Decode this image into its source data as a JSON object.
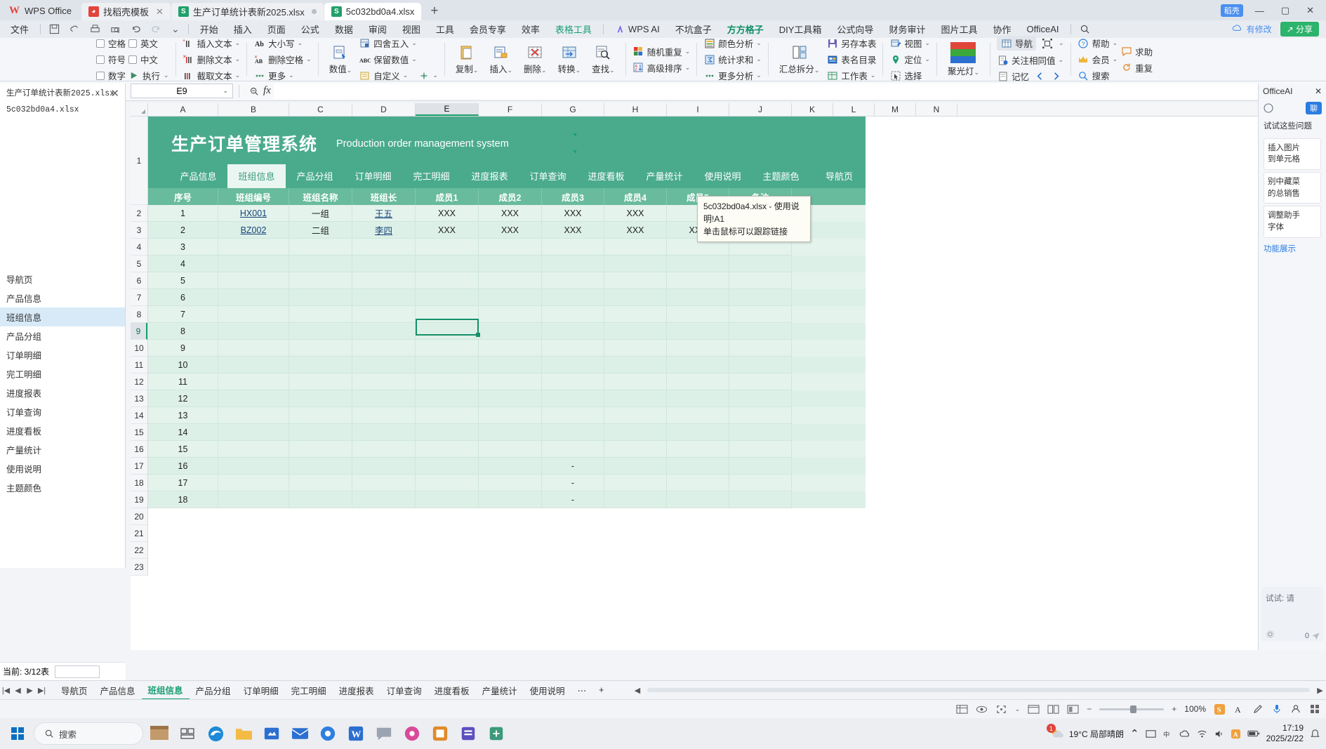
{
  "window": {
    "app_name": "WPS Office",
    "tabs": [
      {
        "label": "找稻壳模板",
        "icon": "wps-red-icon",
        "active": false,
        "closable": true
      },
      {
        "label": "生产订单统计表新2025.xlsx",
        "icon": "sheet-green-icon",
        "active": false,
        "dot": true
      },
      {
        "label": "5c032bd0a4.xlsx",
        "icon": "sheet-green-icon",
        "active": true
      }
    ],
    "new_tab": "+",
    "vip_badge": "稻壳",
    "minimize": "—",
    "maximize": "▢",
    "close": "✕"
  },
  "menu": {
    "file": "文件",
    "quick_access": [
      "save-icon",
      "cloud-icon",
      "print-icon",
      "print-preview-icon",
      "undo-icon",
      "redo-icon",
      "customize-chevron-icon"
    ],
    "items": [
      {
        "label": "开始"
      },
      {
        "label": "插入"
      },
      {
        "label": "页面"
      },
      {
        "label": "公式"
      },
      {
        "label": "数据"
      },
      {
        "label": "审阅"
      },
      {
        "label": "视图"
      },
      {
        "label": "工具"
      },
      {
        "label": "会员专享"
      },
      {
        "label": "效率"
      },
      {
        "label": "表格工具",
        "style": "teal"
      },
      {
        "label": "WPS AI",
        "style": "ai"
      },
      {
        "label": "不坑盒子"
      },
      {
        "label": "方方格子",
        "style": "active"
      },
      {
        "label": "DIY工具箱"
      },
      {
        "label": "公式向导"
      },
      {
        "label": "财务审计"
      },
      {
        "label": "图片工具"
      },
      {
        "label": "协作"
      },
      {
        "label": "OfficeAI"
      }
    ],
    "search_icon": "search-icon",
    "modified_label": "有修改",
    "share_label": "分享"
  },
  "ribbon": {
    "groups": [
      {
        "name": "checkboxes",
        "checkboxes": [
          {
            "label": "空格"
          },
          {
            "label": "英文"
          },
          {
            "label": "符号"
          },
          {
            "label": "中文"
          },
          {
            "label": "数字"
          },
          {
            "label": "执行"
          }
        ]
      },
      {
        "name": "text-tools",
        "items": [
          {
            "label": "插入文本",
            "icon": "insert-text-icon"
          },
          {
            "label": "删除文本",
            "icon": "delete-text-icon"
          },
          {
            "label": "截取文本",
            "icon": "extract-text-icon"
          }
        ]
      },
      {
        "name": "case-tools",
        "items": [
          {
            "label": "大小写",
            "icon": "case-icon"
          },
          {
            "label": "删除空格",
            "icon": "remove-space-icon"
          },
          {
            "label": "更多",
            "icon": "more-icon"
          }
        ]
      },
      {
        "name": "value-tools",
        "big": {
          "label": "数值",
          "icon": "numeric-icon"
        },
        "items": [
          {
            "label": "四舍五入",
            "icon": "round-icon"
          },
          {
            "label": "保留数值",
            "icon": "keep-value-icon"
          },
          {
            "label": "自定义",
            "icon": "custom-icon"
          },
          {
            "label": "",
            "icon": "plus-more-icon"
          }
        ]
      },
      {
        "name": "edit-tools",
        "buttons": [
          {
            "label": "复制",
            "icon": "copy-icon"
          },
          {
            "label": "插入",
            "icon": "insert-icon"
          },
          {
            "label": "删除",
            "icon": "delete-icon"
          },
          {
            "label": "转换",
            "icon": "convert-icon"
          },
          {
            "label": "查找",
            "icon": "find-icon"
          }
        ]
      },
      {
        "name": "random-sort",
        "items": [
          {
            "label": "随机重复",
            "icon": "random-repeat-icon"
          },
          {
            "label": "高级排序",
            "icon": "advanced-sort-icon"
          }
        ]
      },
      {
        "name": "analysis",
        "items": [
          {
            "label": "颜色分析",
            "icon": "color-analysis-icon"
          },
          {
            "label": "统计求和",
            "icon": "stat-sum-icon"
          },
          {
            "label": "更多分析",
            "icon": "more-analysis-icon"
          }
        ]
      },
      {
        "name": "workbook",
        "big": {
          "label": "汇总拆分",
          "icon": "merge-split-icon"
        },
        "items": [
          {
            "label": "另存本表",
            "icon": "save-sheet-icon"
          },
          {
            "label": "表名目录",
            "icon": "sheet-list-icon"
          },
          {
            "label": "工作表",
            "icon": "worksheet-icon"
          }
        ]
      },
      {
        "name": "view-tools",
        "items": [
          {
            "label": "视图",
            "icon": "view-icon"
          },
          {
            "label": "定位",
            "icon": "locate-icon"
          },
          {
            "label": "选择",
            "icon": "select-icon"
          }
        ]
      },
      {
        "name": "spotlight",
        "big": {
          "label": "聚光灯",
          "icon": "spotlight-icon"
        }
      },
      {
        "name": "navigation",
        "items": [
          {
            "label": "导航",
            "icon": "nav-icon",
            "selected": true
          },
          {
            "label": "关注相同值",
            "icon": "watch-same-icon"
          },
          {
            "label": "记忆",
            "icon": "memory-icon"
          }
        ],
        "extra": [
          {
            "label": "",
            "icon": "resize-icon"
          },
          {
            "label": "",
            "icon": "arrow-left-icon"
          },
          {
            "label": "",
            "icon": "arrow-right-icon"
          }
        ]
      },
      {
        "name": "help",
        "items": [
          {
            "label": "帮助",
            "icon": "help-icon"
          },
          {
            "label": "会员",
            "icon": "vip-icon"
          },
          {
            "label": "搜索",
            "icon": "search-small-icon"
          },
          {
            "label": "求助",
            "icon": "ask-icon"
          },
          {
            "label": "重复",
            "icon": "repeat-icon"
          }
        ]
      }
    ]
  },
  "formula_bar": {
    "name_box": "E9",
    "name_box_chevron": "chevron-down-icon",
    "zoom_icon": "search-minus-icon",
    "fx": "fx",
    "value": "",
    "expand_icon": "expand-formula-icon"
  },
  "left_panel": {
    "close": "✕",
    "files": [
      "生产订单统计表新2025.xlsx",
      "5c032bd0a4.xlsx"
    ],
    "nav_items": [
      {
        "label": "导航页"
      },
      {
        "label": "产品信息"
      },
      {
        "label": "班组信息",
        "selected": true
      },
      {
        "label": "产品分组"
      },
      {
        "label": "订单明细"
      },
      {
        "label": "完工明细"
      },
      {
        "label": "进度报表"
      },
      {
        "label": "订单查询"
      },
      {
        "label": "进度看板"
      },
      {
        "label": "产量统计"
      },
      {
        "label": "使用说明"
      },
      {
        "label": "主题颜色"
      }
    ],
    "count_label": "当前:  3/12表",
    "count_value": ""
  },
  "sheet": {
    "banner": {
      "title": "生产订单管理系统",
      "subtitle": "Production order management system"
    },
    "nav_tabs": [
      {
        "label": "产品信息",
        "active": false
      },
      {
        "label": "班组信息",
        "active": true
      },
      {
        "label": "产品分组",
        "active": false
      },
      {
        "label": "订单明细",
        "active": false
      },
      {
        "label": "完工明细",
        "active": false
      },
      {
        "label": "进度报表",
        "active": false
      },
      {
        "label": "订单查询",
        "active": false
      },
      {
        "label": "进度看板",
        "active": false
      },
      {
        "label": "产量统计",
        "active": false
      },
      {
        "label": "使用说明",
        "active": false
      },
      {
        "label": "主题颜色",
        "active": false
      },
      {
        "label": "导航页",
        "active": false
      }
    ],
    "columns": [
      "A",
      "B",
      "C",
      "D",
      "E",
      "F",
      "G",
      "H",
      "I",
      "J",
      "K",
      "L",
      "M",
      "N"
    ],
    "active_column": "E",
    "active_row": 9,
    "row_numbers": [
      1,
      2,
      3,
      4,
      5,
      6,
      7,
      8,
      9,
      10,
      11,
      12,
      13,
      14,
      15,
      16,
      17,
      18,
      19,
      20,
      21,
      22,
      23
    ],
    "headers": [
      "序号",
      "班组编号",
      "班组名称",
      "班组长",
      "成员1",
      "成员2",
      "成员3",
      "成员4",
      "成员5",
      "备注"
    ],
    "rows": [
      {
        "no": "1",
        "code": "HX001",
        "name": "一组",
        "leader": "王五",
        "m1": "XXX",
        "m2": "XXX",
        "m3": "XXX",
        "m4": "XXX",
        "m5": "",
        "note": ""
      },
      {
        "no": "2",
        "code": "BZ002",
        "name": "二组",
        "leader": "李四",
        "m1": "XXX",
        "m2": "XXX",
        "m3": "XXX",
        "m4": "XXX",
        "m5": "XXX",
        "note": ""
      },
      {
        "no": "3",
        "code": "",
        "name": "",
        "leader": "",
        "m1": "",
        "m2": "",
        "m3": "",
        "m4": "",
        "m5": "",
        "note": ""
      },
      {
        "no": "4",
        "code": "",
        "name": "",
        "leader": "",
        "m1": "",
        "m2": "",
        "m3": "",
        "m4": "",
        "m5": "",
        "note": ""
      },
      {
        "no": "5",
        "code": "",
        "name": "",
        "leader": "",
        "m1": "",
        "m2": "",
        "m3": "",
        "m4": "",
        "m5": "",
        "note": ""
      },
      {
        "no": "6",
        "code": "",
        "name": "",
        "leader": "",
        "m1": "",
        "m2": "",
        "m3": "",
        "m4": "",
        "m5": "",
        "note": ""
      },
      {
        "no": "7",
        "code": "",
        "name": "",
        "leader": "",
        "m1": "",
        "m2": "",
        "m3": "",
        "m4": "",
        "m5": "",
        "note": ""
      },
      {
        "no": "8",
        "code": "",
        "name": "",
        "leader": "",
        "m1": "",
        "m2": "",
        "m3": "",
        "m4": "",
        "m5": "",
        "note": ""
      },
      {
        "no": "9",
        "code": "",
        "name": "",
        "leader": "",
        "m1": "",
        "m2": "",
        "m3": "",
        "m4": "",
        "m5": "",
        "note": ""
      },
      {
        "no": "10",
        "code": "",
        "name": "",
        "leader": "",
        "m1": "",
        "m2": "",
        "m3": "",
        "m4": "",
        "m5": "",
        "note": ""
      },
      {
        "no": "11",
        "code": "",
        "name": "",
        "leader": "",
        "m1": "",
        "m2": "",
        "m3": "",
        "m4": "",
        "m5": "",
        "note": ""
      },
      {
        "no": "12",
        "code": "",
        "name": "",
        "leader": "",
        "m1": "",
        "m2": "",
        "m3": "",
        "m4": "",
        "m5": "",
        "note": ""
      },
      {
        "no": "13",
        "code": "",
        "name": "",
        "leader": "",
        "m1": "",
        "m2": "",
        "m3": "",
        "m4": "",
        "m5": "",
        "note": ""
      },
      {
        "no": "14",
        "code": "",
        "name": "",
        "leader": "",
        "m1": "",
        "m2": "",
        "m3": "",
        "m4": "",
        "m5": "",
        "note": ""
      },
      {
        "no": "15",
        "code": "",
        "name": "",
        "leader": "",
        "m1": "",
        "m2": "",
        "m3": "",
        "m4": "",
        "m5": "",
        "note": ""
      },
      {
        "no": "16",
        "code": "",
        "name": "",
        "leader": "",
        "m1": "",
        "m2": "",
        "m3": "-",
        "m4": "",
        "m5": "",
        "note": ""
      },
      {
        "no": "17",
        "code": "",
        "name": "",
        "leader": "",
        "m1": "",
        "m2": "",
        "m3": "-",
        "m4": "",
        "m5": "",
        "note": ""
      },
      {
        "no": "18",
        "code": "",
        "name": "",
        "leader": "",
        "m1": "",
        "m2": "",
        "m3": "-",
        "m4": "",
        "m5": "",
        "note": ""
      }
    ]
  },
  "tooltip": {
    "line1": "5c032bd0a4.xlsx - 使用说明!A1",
    "line2": "单击鼠标可以跟踪链接"
  },
  "right_panel": {
    "title": "OfficeAI",
    "close": "✕",
    "badge": "聊",
    "heading": "试试这些问题",
    "items": [
      "插入图片\n到单元格",
      "别中藏菜\n的总销售",
      "调整助手\n字体"
    ],
    "link": "功能展示",
    "try_label": "试试: 请",
    "settings_icon": "gear-icon",
    "count": "0"
  },
  "sheet_tabs": {
    "nav": [
      "first-sheet-icon",
      "prev-sheet-icon",
      "next-sheet-icon",
      "last-sheet-icon"
    ],
    "tabs": [
      {
        "label": "导航页",
        "active": false
      },
      {
        "label": "产品信息",
        "active": false
      },
      {
        "label": "班组信息",
        "active": true
      },
      {
        "label": "产品分组",
        "active": false
      },
      {
        "label": "订单明细",
        "active": false
      },
      {
        "label": "完工明细",
        "active": false
      },
      {
        "label": "进度报表",
        "active": false
      },
      {
        "label": "订单查询",
        "active": false
      },
      {
        "label": "进度看板",
        "active": false
      },
      {
        "label": "产量统计",
        "active": false
      },
      {
        "label": "使用说明",
        "active": false
      }
    ],
    "more": "⋯",
    "add": "+"
  },
  "status_bar": {
    "view_icons": [
      "page-layout-icon",
      "read-mode-icon",
      "fullscreen-icon",
      "normal-view-icon",
      "page-break-icon",
      "custom-view-icon"
    ],
    "zoom": "100%",
    "zoom_out": "−",
    "zoom_in": "+",
    "right_icons": [
      "wps-s-icon",
      "font-a-icon",
      "pencil-icon",
      "mic-icon",
      "user-icon",
      "grid-icon"
    ]
  },
  "taskbar": {
    "start_icon": "windows-icon",
    "search_placeholder": "搜索",
    "apps": [
      "task-view-icon",
      "edge-icon",
      "folder-icon",
      "store-icon",
      "mail-icon",
      "browser-icon",
      "word-icon",
      "chat-icon",
      "photos-icon",
      "media-icon",
      "notes-icon",
      "files-icon"
    ],
    "weather": "19°C  局部晴朗",
    "time": "17:19",
    "date": "2025/2/22",
    "tray_icons": [
      "chevron-up-icon",
      "wps-tray-icon",
      "input-icon",
      "cloud-tray-icon",
      "volume-icon",
      "network-icon",
      "battery-icon"
    ],
    "notify_badge": "1"
  }
}
